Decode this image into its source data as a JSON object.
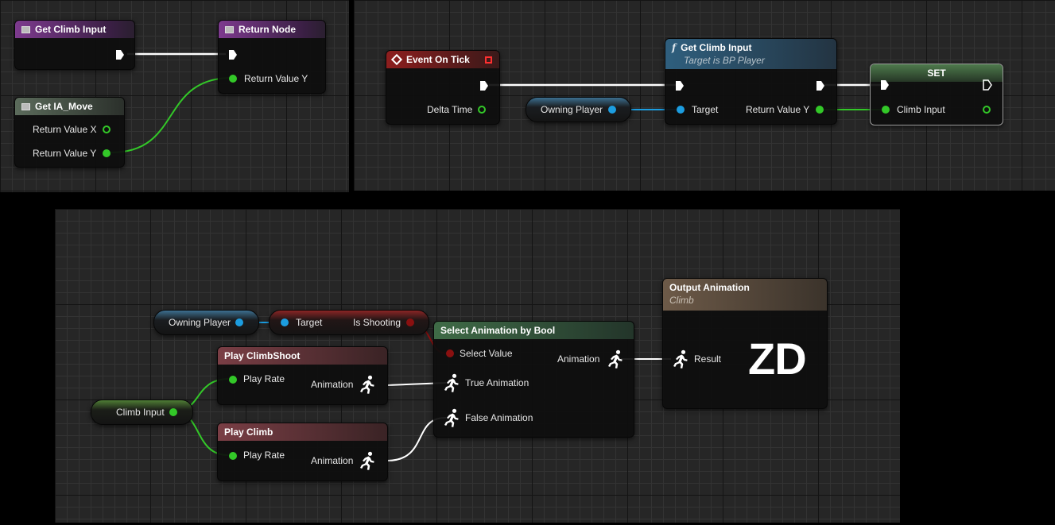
{
  "panel1": {
    "get_climb_input": {
      "title": "Get Climb Input"
    },
    "return_node": {
      "title": "Return Node",
      "pin_return_y": "Return Value Y"
    },
    "get_ia_move": {
      "title": "Get IA_Move",
      "pin_x": "Return Value X",
      "pin_y": "Return Value Y"
    }
  },
  "panel2": {
    "event_tick": {
      "title": "Event On Tick",
      "pin_delta": "Delta Time"
    },
    "owning_player": "Owning Player",
    "get_climb_input": {
      "title": "Get Climb Input",
      "subtitle": "Target is BP Player",
      "pin_target": "Target",
      "pin_return_y": "Return Value Y"
    },
    "set": {
      "title": "SET",
      "pin_climb_input": "Climb Input"
    }
  },
  "panel3": {
    "owning_player": "Owning Player",
    "is_shooting": {
      "pin_target": "Target",
      "pin_value": "Is Shooting"
    },
    "play_climbshoot": {
      "title": "Play ClimbShoot",
      "pin_rate": "Play Rate",
      "pin_anim": "Animation"
    },
    "play_climb": {
      "title": "Play Climb",
      "pin_rate": "Play Rate",
      "pin_anim": "Animation"
    },
    "climb_input": "Climb Input",
    "select_anim": {
      "title": "Select Animation by Bool",
      "pin_select": "Select Value",
      "pin_true": "True Animation",
      "pin_false": "False Animation",
      "pin_anim": "Animation"
    },
    "output_anim": {
      "title": "Output Animation",
      "subtitle": "Climb",
      "pin_result": "Result",
      "logo": "ZD"
    }
  },
  "icons": [
    "function-icon",
    "event-icon",
    "exec-pin",
    "data-pin",
    "animation-pin-icon"
  ],
  "colors": {
    "exec_wire": "#ffffff",
    "float_wire": "#33c828",
    "object_wire": "#1c9de0",
    "bool_pin": "#8a1010",
    "anim_wire": "#ffffff"
  }
}
